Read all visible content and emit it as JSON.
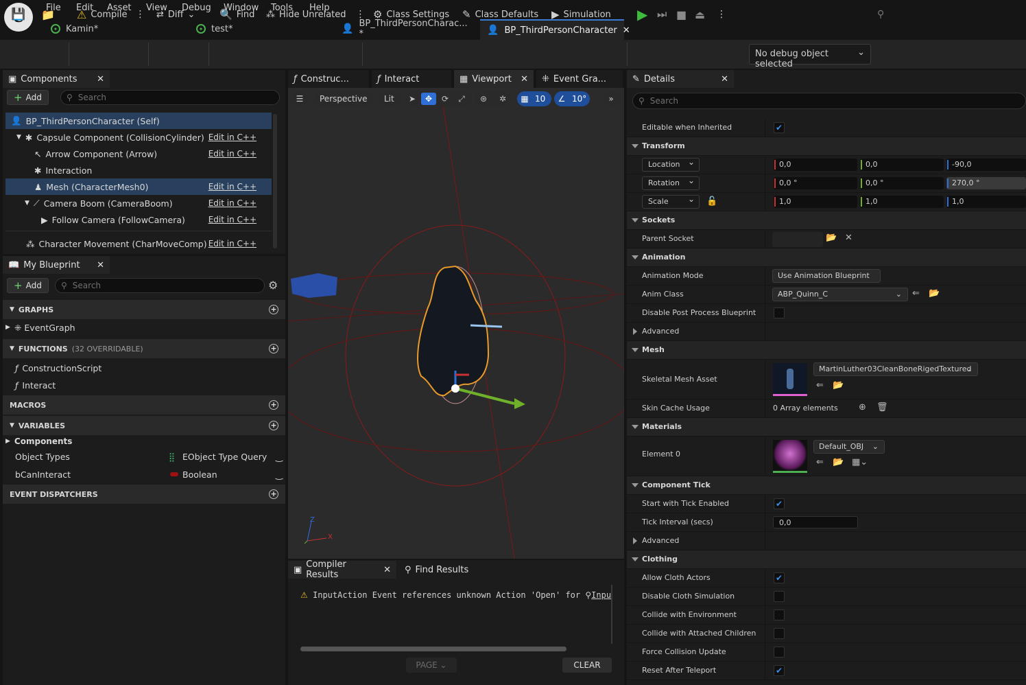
{
  "menu": [
    "File",
    "Edit",
    "Asset",
    "View",
    "Debug",
    "Window",
    "Tools",
    "Help"
  ],
  "doc_tabs": [
    {
      "label": "Kamin*"
    },
    {
      "label": "test*"
    },
    {
      "label": "BP_ThirdPersonCharac... *"
    },
    {
      "label": "BP_ThirdPersonCharacter"
    }
  ],
  "toolbar": {
    "compile": "Compile",
    "diff": "Diff",
    "find": "Find",
    "hide_unrelated": "Hide Unrelated",
    "class_settings": "Class Settings",
    "class_defaults": "Class Defaults",
    "simulation": "Simulation",
    "debug_object": "No debug object selected"
  },
  "components": {
    "tab": "Components",
    "add": "Add",
    "search_placeholder": "Search",
    "edit_cpp": "Edit in C++",
    "items": [
      {
        "label": "BP_ThirdPersonCharacter (Self)"
      },
      {
        "label": "Capsule Component (CollisionCylinder)"
      },
      {
        "label": "Arrow Component (Arrow)"
      },
      {
        "label": "Interaction"
      },
      {
        "label": "Mesh (CharacterMesh0)"
      },
      {
        "label": "Camera Boom (CameraBoom)"
      },
      {
        "label": "Follow Camera (FollowCamera)"
      },
      {
        "label": "Character Movement (CharMoveComp)"
      }
    ]
  },
  "my_blueprint": {
    "tab": "My Blueprint",
    "add": "Add",
    "search_placeholder": "Search",
    "graphs": "GRAPHS",
    "event_graph": "EventGraph",
    "functions": "FUNCTIONS",
    "functions_sub": "(32 OVERRIDABLE)",
    "construction_script": "ConstructionScript",
    "interact": "Interact",
    "macros": "MACROS",
    "variables": "VARIABLES",
    "components_cat": "Components",
    "var1_name": "Object Types",
    "var1_type": "EObject Type Query",
    "var2_name": "bCanInteract",
    "var2_type": "Boolean",
    "event_dispatchers": "EVENT DISPATCHERS"
  },
  "center_tabs": [
    "Construc...",
    "Interact",
    "Viewport",
    "Event Gra..."
  ],
  "viewport": {
    "perspective": "Perspective",
    "lit": "Lit",
    "grid": "10",
    "angle": "10°",
    "axis_x": "X",
    "axis_z": "Z"
  },
  "bottom": {
    "compiler_tab": "Compiler Results",
    "find_tab": "Find Results",
    "message": "InputAction Event references unknown Action 'Open' for",
    "link": "Inpu",
    "page": "PAGE",
    "clear": "CLEAR"
  },
  "details": {
    "tab": "Details",
    "search_placeholder": "Search",
    "editable_when_inherited": "Editable when Inherited",
    "transform": "Transform",
    "location": "Location",
    "location_vals": [
      "0,0",
      "0,0",
      "-90,0"
    ],
    "rotation": "Rotation",
    "rotation_vals": [
      "0,0 °",
      "0,0 °",
      "270,0 °"
    ],
    "scale": "Scale",
    "scale_vals": [
      "1,0",
      "1,0",
      "1,0"
    ],
    "sockets": "Sockets",
    "parent_socket": "Parent Socket",
    "animation": "Animation",
    "animation_mode": "Animation Mode",
    "animation_mode_val": "Use Animation Blueprint",
    "anim_class": "Anim Class",
    "anim_class_val": "ABP_Quinn_C",
    "disable_post_process": "Disable Post Process Blueprint",
    "advanced": "Advanced",
    "mesh": "Mesh",
    "skeletal_mesh_asset": "Skeletal Mesh Asset",
    "skeletal_mesh_val": "MartinLuther03CleanBoneRigedTextured",
    "skin_cache_usage": "Skin Cache Usage",
    "skin_cache_val": "0 Array elements",
    "materials": "Materials",
    "element0": "Element 0",
    "element0_val": "Default_OBJ",
    "component_tick": "Component Tick",
    "start_with_tick": "Start with Tick Enabled",
    "tick_interval": "Tick Interval (secs)",
    "tick_interval_val": "0,0",
    "clothing": "Clothing",
    "allow_cloth_actors": "Allow Cloth Actors",
    "disable_cloth_sim": "Disable Cloth Simulation",
    "collide_env": "Collide with Environment",
    "collide_attached": "Collide with Attached Children",
    "force_collision": "Force Collision Update",
    "reset_after_teleport": "Reset After Teleport"
  },
  "colors": {
    "accent": "#3a7bd5",
    "selection": "#28405e",
    "play_green": "#3dbb3d",
    "warning": "#e8b920",
    "x_axis": "#c83232",
    "y_axis": "#6fb12b",
    "z_axis": "#2f6fd6"
  }
}
